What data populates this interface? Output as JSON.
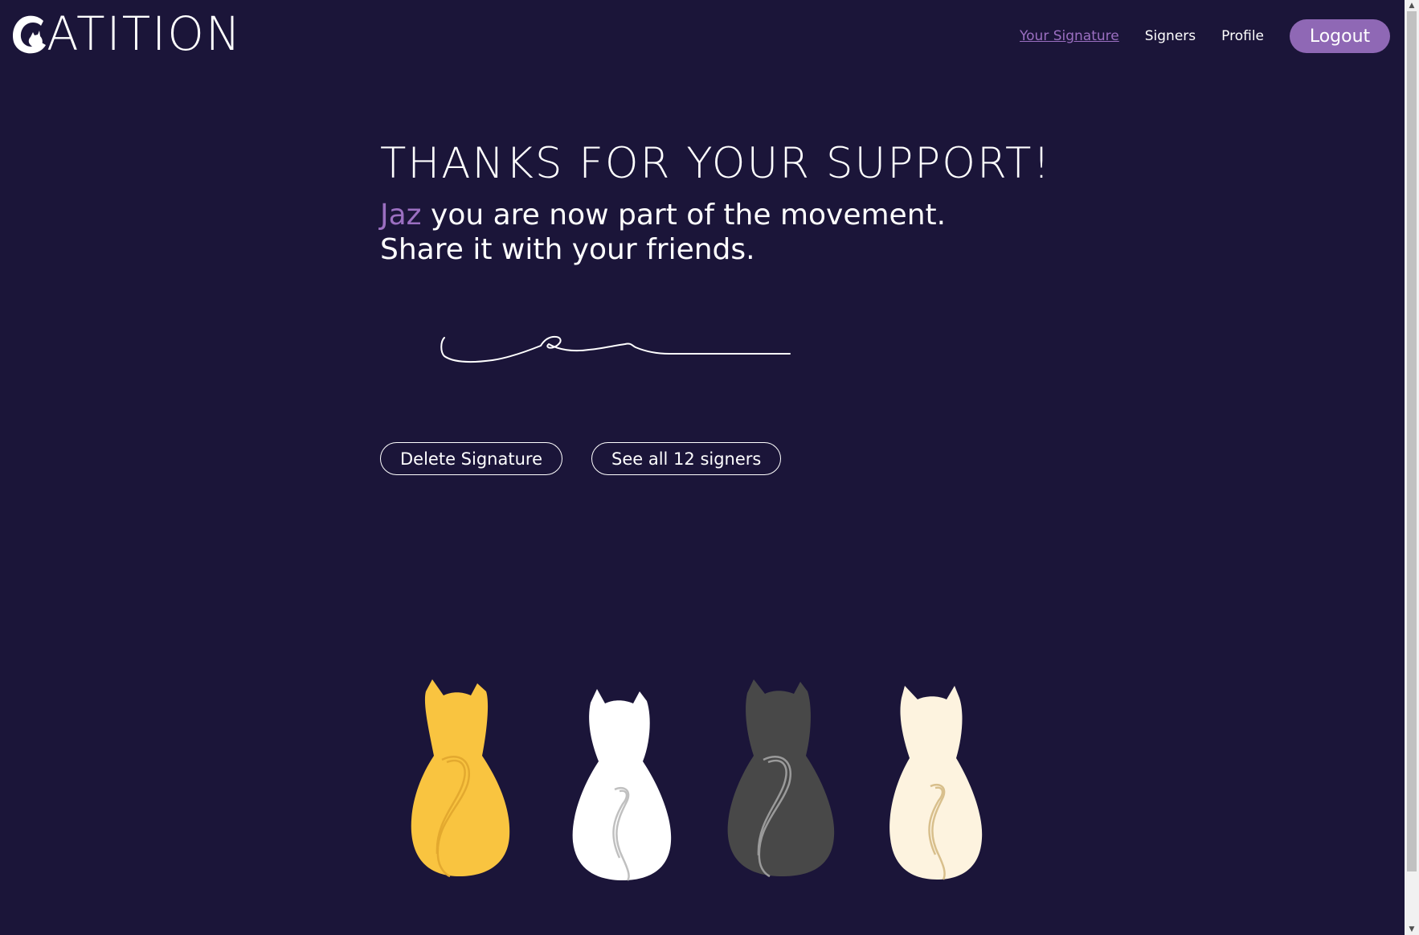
{
  "logo": {
    "text": "ATITION"
  },
  "nav": {
    "items": [
      {
        "label": "Your Signature",
        "active": true
      },
      {
        "label": "Signers",
        "active": false
      },
      {
        "label": "Profile",
        "active": false
      }
    ],
    "logout_label": "Logout"
  },
  "main": {
    "headline": "THANKS FOR YOUR SUPPORT!",
    "user_name": "Jaz",
    "message_line1": " you are now part of the movement.",
    "message_line2": "Share it with your friends."
  },
  "actions": {
    "delete_label": "Delete Signature",
    "signers_label": "See all 12 signers"
  },
  "colors": {
    "background": "#1b1539",
    "accent": "#9b6fc1",
    "logout_bg": "#8f68b5",
    "cat_yellow": "#f9c440",
    "cat_white": "#ffffff",
    "cat_gray": "#484848",
    "cat_cream": "#fdf3df"
  }
}
